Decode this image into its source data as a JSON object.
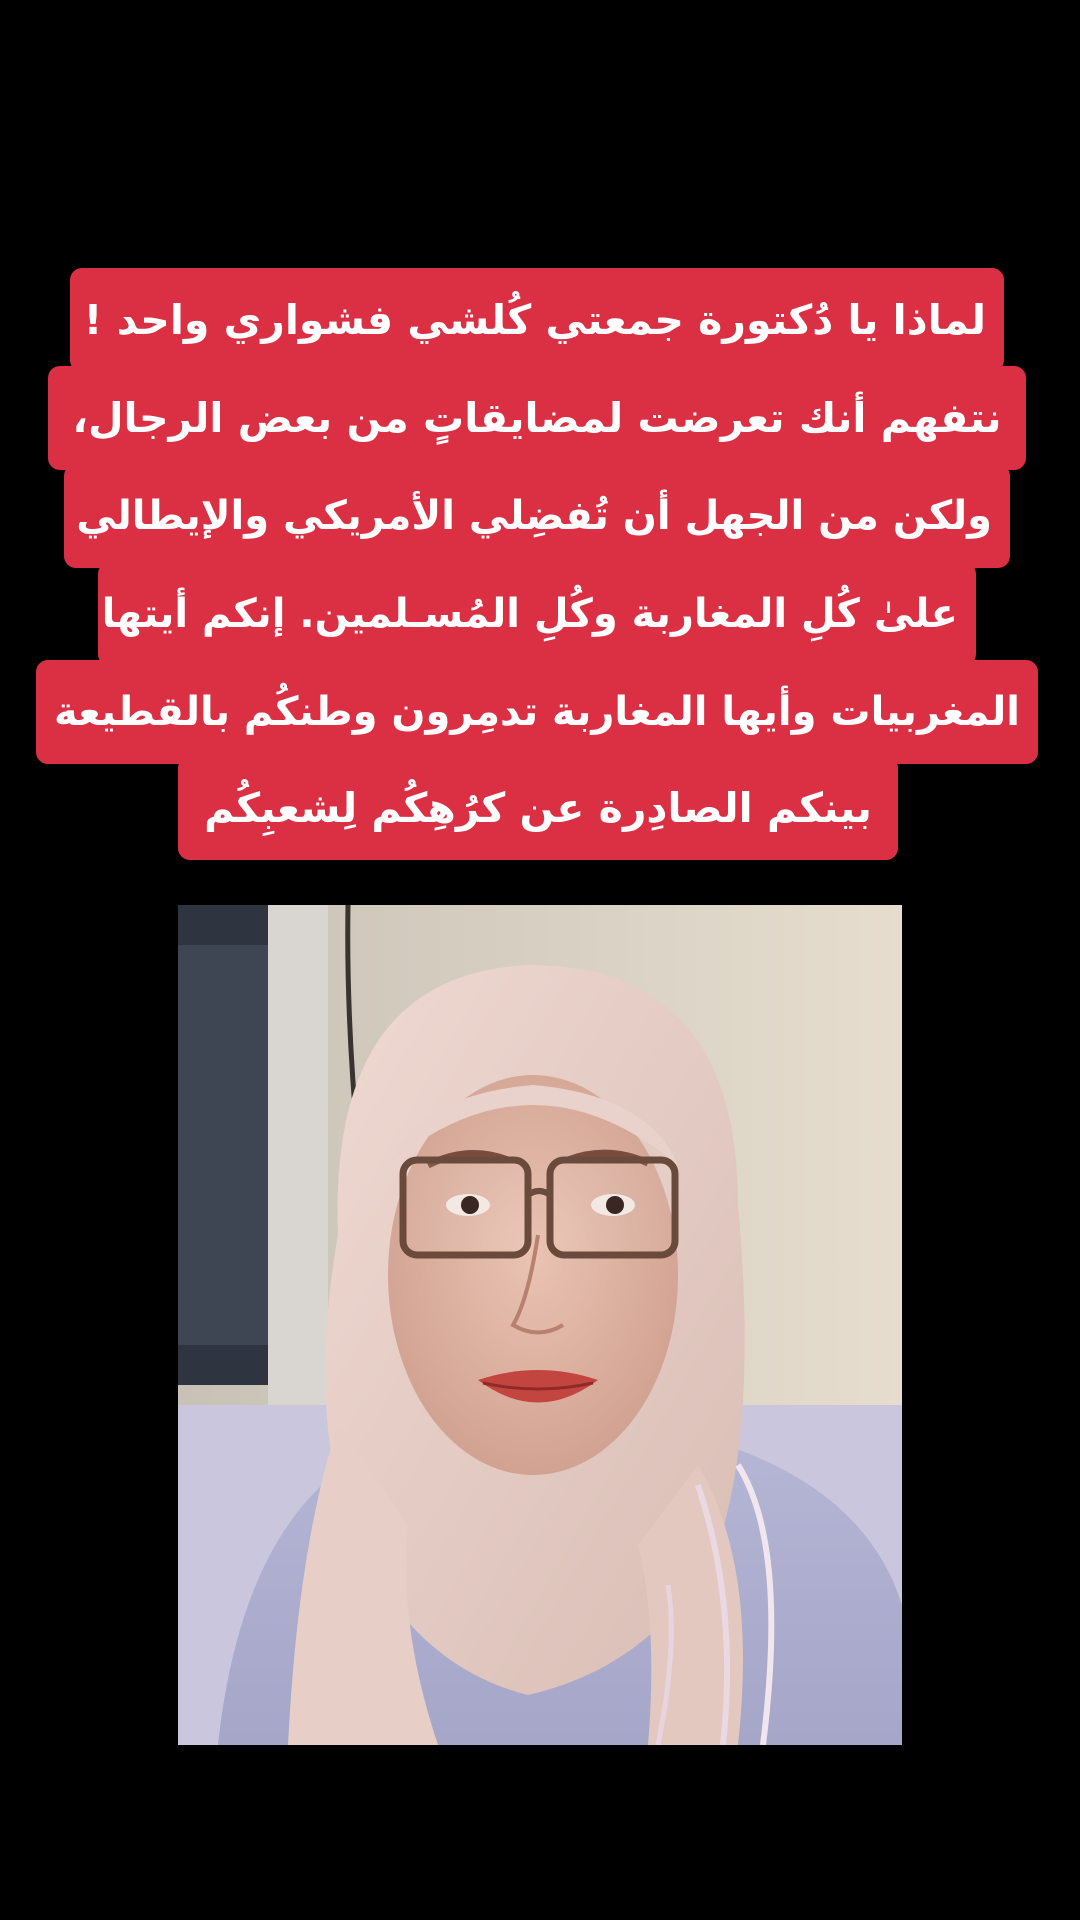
{
  "caption": {
    "lines": [
      "لماذا يا دُكتورة جمعتي كُلشي فشواري واحد !",
      "نتفهم أنك تعرضت لمضايقاتٍ من  بعض الرجال،",
      "ولكن من الجهل أن تُفضِلي الأمريكي والإيطالي",
      "علىٰ كُلِ المغاربة وكُلِ المُسـلمين. إنكم أيتها",
      "المغربيات وأيها المغاربة تدمِرون وطنكُم بالقطيعة",
      "بينكم  الصادِرة عن كرُهِكُم لِشعبِكُم"
    ],
    "background_color": "#db3044",
    "text_color": "#ffffff"
  },
  "video": {
    "subject": "woman-in-hijab-with-glasses",
    "accessory_icon": "stethoscope-icon"
  }
}
